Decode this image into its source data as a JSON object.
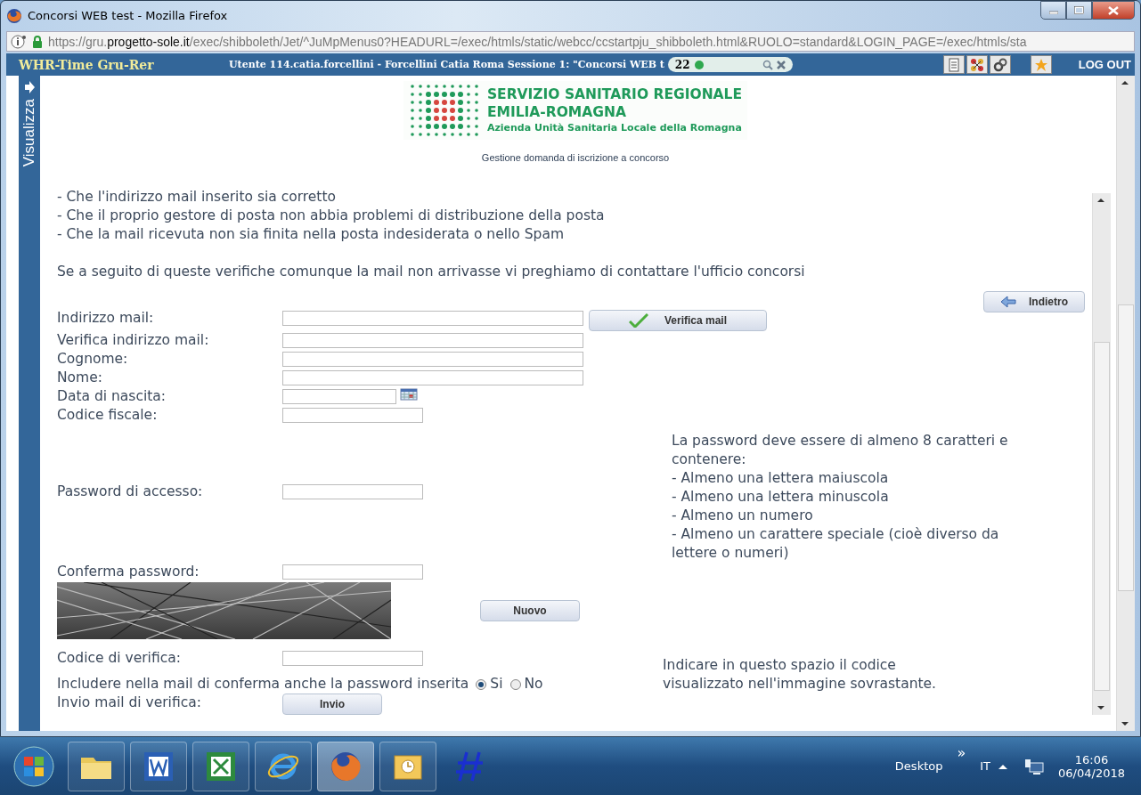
{
  "window": {
    "title": "Concorsi WEB test - Mozilla Firefox"
  },
  "address_bar": {
    "url_parts": [
      {
        "text": "https://gru.",
        "highlight": false
      },
      {
        "text": "progetto-sole.it",
        "highlight": true
      },
      {
        "text": "/exec/shibboleth/Jet/^JuMpMenus0?HEADURL=/exec/htmls/static/webcc/ccstartpju_shibboleth.html&RUOLO=standard&LOGIN_PAGE=/exec/htmls/sta",
        "highlight": false
      }
    ]
  },
  "app_header": {
    "title": "WHR-Time Gru-Rer",
    "user": "Utente 114.catia.forcellini - Forcellini Catia Roma",
    "session": "Sessione 1: \"Concorsi WEB t",
    "badge_count": "22",
    "logout": "LOG OUT"
  },
  "sidebar_tab": {
    "label": "Visualizza"
  },
  "logo": {
    "line1": "SERVIZIO SANITARIO REGIONALE",
    "line2": "EMILIA-ROMAGNA",
    "line3": "Azienda Unità Sanitaria Locale della Romagna"
  },
  "subtitle": "Gestione domanda di iscrizione a concorso",
  "notes": [
    "- Che l'indirizzo mail inserito sia corretto",
    "- Che il proprio gestore di posta non abbia problemi di distribuzione della posta",
    "- Che la mail ricevuta non sia finita nella posta indesiderata o nello Spam"
  ],
  "contact_note": "Se a seguito di queste verifiche comunque la mail non arrivasse vi preghiamo di contattare l'ufficio concorsi",
  "back_button": "Indietro",
  "fields": [
    {
      "label": "Indirizzo mail:",
      "kind": "wide"
    },
    {
      "label": "Verifica indirizzo mail:",
      "kind": "wide"
    },
    {
      "label": "Cognome:",
      "kind": "wide"
    },
    {
      "label": "Nome:",
      "kind": "wide"
    },
    {
      "label": "Data di nascita:",
      "kind": "date"
    },
    {
      "label": "Codice fiscale:",
      "kind": "short"
    }
  ],
  "verify_button": "Verifica mail",
  "password": {
    "label": "Password di accesso:",
    "confirm_label": "Conferma password:"
  },
  "password_rules": [
    "La password deve essere di almeno 8 caratteri e contenere:",
    "- Almeno una lettera maiuscola",
    "- Almeno una lettera minuscola",
    "- Almeno un numero",
    "- Almeno un carattere speciale (cioè diverso da lettere o numeri)"
  ],
  "captcha": {
    "new_button": "Nuovo",
    "code_label": "Codice di verifica:",
    "hint": "Indicare in questo spazio il codice visualizzato nell'immagine sovrastante."
  },
  "include_password": {
    "label": "Includere nella mail di conferma anche la password inserita",
    "options": [
      {
        "label": "Si",
        "selected": true
      },
      {
        "label": "No",
        "selected": false
      }
    ]
  },
  "send": {
    "label": "Invio mail di verifica:",
    "button": "Invio"
  },
  "taskbar": {
    "desktop": "Desktop",
    "overflow": "»",
    "language": "IT",
    "time": "16:06",
    "date": "06/04/2018"
  }
}
